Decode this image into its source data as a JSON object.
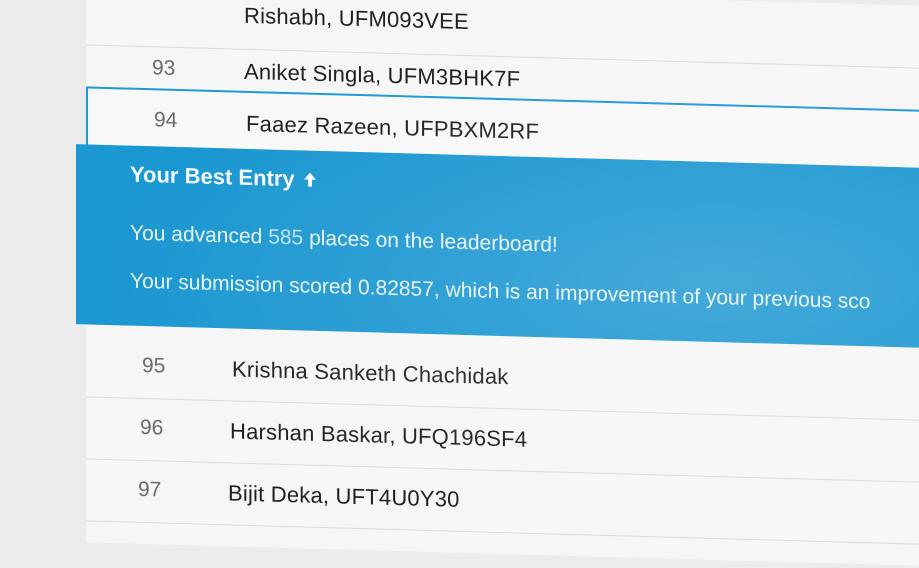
{
  "leaderboard": {
    "rows": [
      {
        "rank": "",
        "name": "Rishabh, UFM093VEE"
      },
      {
        "rank": "93",
        "name": "Aniket Singla, UFM3BHK7F"
      },
      {
        "rank": "94",
        "name": "Faaez Razeen, UFPBXM2RF"
      },
      {
        "rank": "95",
        "name": "Krishna Sanketh Chachidak"
      },
      {
        "rank": "96",
        "name": "Harshan Baskar, UFQ196SF4"
      },
      {
        "rank": "97",
        "name": "Bijit Deka, UFT4U0Y30"
      }
    ]
  },
  "banner": {
    "title": "Your Best Entry",
    "advanced_prefix": "You advanced ",
    "advanced_count": "585",
    "advanced_suffix": " places on the leaderboard!",
    "score_text": "Your submission scored 0.82857, which is an improvement of your previous sco"
  },
  "colors": {
    "banner_bg": "#1b97d1",
    "selected_border": "#1e9ad6",
    "row_bg": "#f6f6f6"
  }
}
